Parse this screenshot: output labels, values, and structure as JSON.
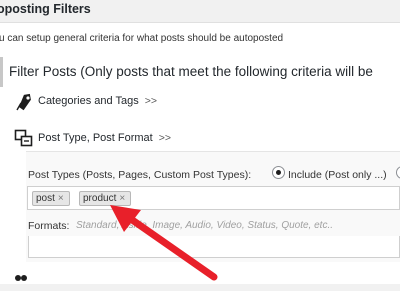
{
  "header": {
    "title": "oposting Filters"
  },
  "intro_text": "u can setup general criteria for what posts should be autoposted",
  "filter_section": {
    "title": "Filter Posts (Only posts that meet the following criteria will be"
  },
  "rows": {
    "categories": {
      "label": "Categories and Tags",
      "chevron": ">>",
      "icon": "tag-icon"
    },
    "post_type": {
      "label": "Post Type, Post Format",
      "chevron": ">>",
      "icon": "post-format-icon"
    }
  },
  "post_types": {
    "label": "Post Types (Posts, Pages, Custom Post Types):",
    "include_label": "Include (Post only ...)",
    "tags": [
      "post",
      "product"
    ],
    "remove_glyph": "×"
  },
  "formats": {
    "label": "Formats:",
    "placeholder": "Standard, Aside, Image, Audio, Video, Status, Quote, etc.."
  },
  "colors": {
    "arrow": "#e8202a",
    "radio_checked": "#1e1e1e"
  }
}
